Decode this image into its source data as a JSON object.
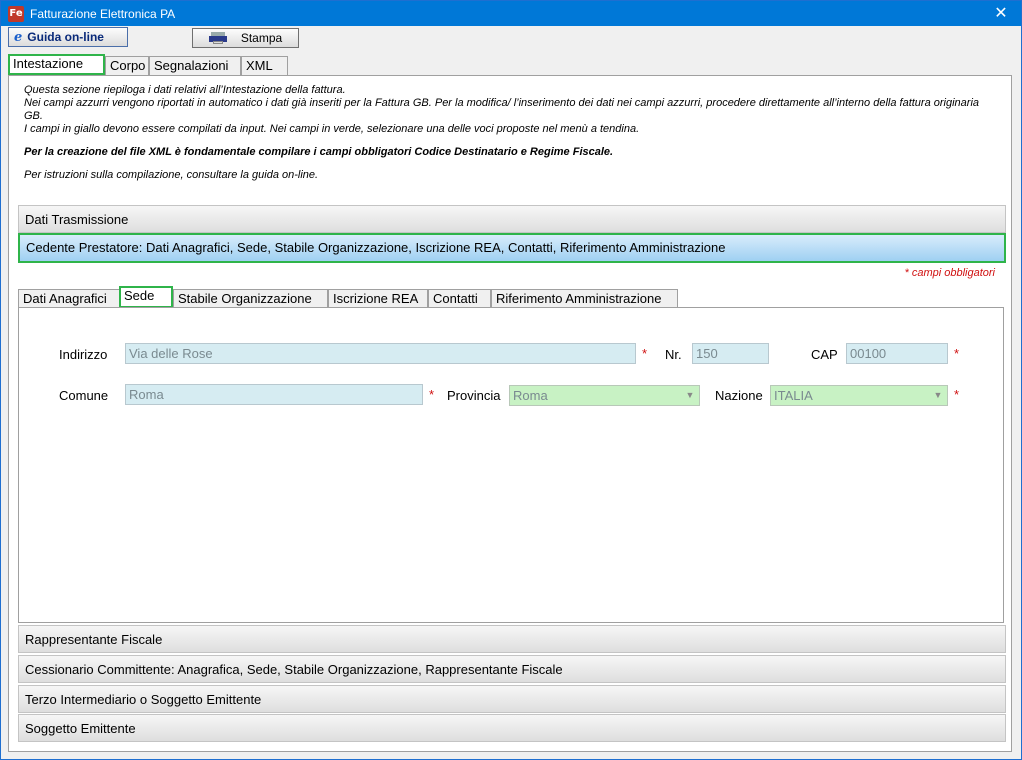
{
  "window": {
    "title": "Fatturazione Elettronica PA",
    "icon_label": "Fe",
    "close_glyph": "✕"
  },
  "toolbar": {
    "guide_label": "Guida on-line",
    "guide_icon": "e",
    "print_label": "Stampa"
  },
  "tabs": [
    {
      "label": "Intestazione"
    },
    {
      "label": "Corpo"
    },
    {
      "label": "Segnalazioni"
    },
    {
      "label": "XML"
    }
  ],
  "info": {
    "line1": "Questa sezione riepiloga i dati relativi all’Intestazione della fattura.",
    "line2": "Nei campi azzurri vengono riportati in automatico i dati già inseriti per la Fattura GB. Per la modifica/ l’inserimento dei dati nei campi azzurri, procedere direttamente all’interno della fattura originaria GB.",
    "line3": "I campi in giallo devono essere compilati da input. Nei campi in verde, selezionare una delle voci proposte nel menù a tendina.",
    "bold": "Per la creazione del file XML è fondamentale compilare i campi obbligatori Codice Destinatario e Regime Fiscale.",
    "last": "Per istruzioni sulla compilazione, consultare la guida on-line."
  },
  "sections": {
    "dati_trasmissione": "Dati Trasmissione",
    "cedente": "Cedente Prestatore: Dati Anagrafici, Sede, Stabile Organizzazione, Iscrizione REA, Contatti, Riferimento Amministrazione",
    "rappresentante": "Rappresentante Fiscale",
    "cessionario": "Cessionario Committente: Anagrafica, Sede, Stabile Organizzazione, Rappresentante Fiscale",
    "terzo": "Terzo Intermediario o Soggetto Emittente",
    "soggetto": "Soggetto Emittente"
  },
  "required_note": "* campi obbligatori",
  "subtabs": [
    {
      "label": "Dati Anagrafici"
    },
    {
      "label": "Sede"
    },
    {
      "label": "Stabile Organizzazione"
    },
    {
      "label": "Iscrizione REA"
    },
    {
      "label": "Contatti"
    },
    {
      "label": "Riferimento Amministrazione"
    }
  ],
  "sede": {
    "indirizzo_label": "Indirizzo",
    "indirizzo_value": "Via delle Rose",
    "nr_label": "Nr.",
    "nr_value": "150",
    "cap_label": "CAP",
    "cap_value": "00100",
    "comune_label": "Comune",
    "comune_value": "Roma",
    "provincia_label": "Provincia",
    "provincia_value": "Roma",
    "nazione_label": "Nazione",
    "nazione_value": "ITALIA",
    "required_mark": "*",
    "dropdown_glyph": "▼"
  },
  "colors": {
    "highlight": "#2fb44a",
    "title_bar": "#0078d7",
    "auto_field": "#d6ecf2",
    "select_field": "#c8f2c4",
    "required": "#d01010"
  }
}
